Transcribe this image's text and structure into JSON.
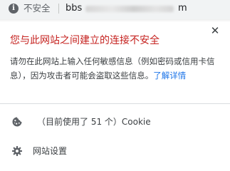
{
  "address_bar": {
    "info_icon_glyph": "i",
    "security_chip": "不安全",
    "url_prefix": "bbs",
    "url_suffix": "m"
  },
  "popup": {
    "close_glyph": "✕",
    "title": "您与此网站之间建立的连接不安全",
    "description": "请勿在此网站上输入任何敏感信息（例如密码或信用卡信息），因为攻击者可能会盗取这些信息。",
    "learn_more": "了解详情",
    "cookie_row": {
      "icon": "cookie-icon",
      "label": "（目前使用了 51 个）Cookie"
    },
    "settings_row": {
      "icon": "gear-icon",
      "label": "网站设置"
    }
  },
  "colors": {
    "title_red": "#c5221f",
    "link_blue": "#1a73e8",
    "icon_gray": "#5f6368",
    "text": "#3c4043"
  }
}
